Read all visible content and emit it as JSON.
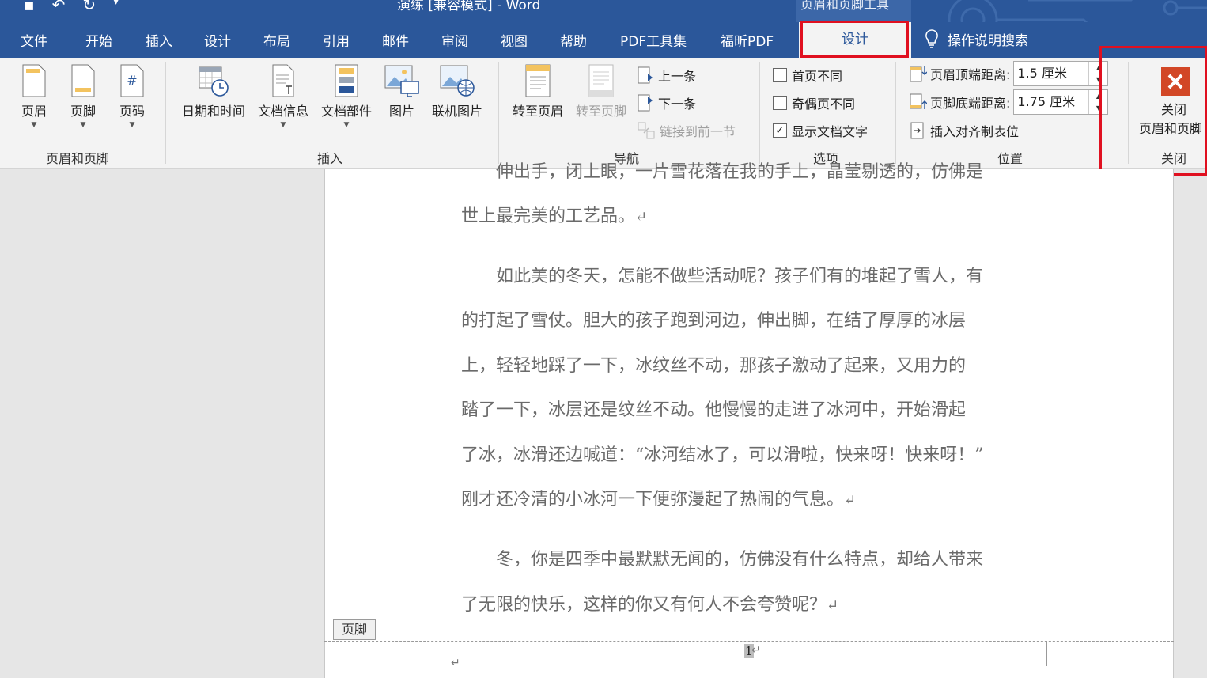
{
  "window": {
    "title": "演练 [兼容模式] - Word",
    "context_title": "页眉和页脚工具"
  },
  "tabs": [
    "文件",
    "开始",
    "插入",
    "设计",
    "布局",
    "引用",
    "邮件",
    "审阅",
    "视图",
    "帮助",
    "PDF工具集",
    "福昕PDF"
  ],
  "context_tab": "设计",
  "tell_me": "操作说明搜索",
  "ribbon": {
    "hf_group": {
      "label": "页眉和页脚",
      "header": "页眉",
      "footer": "页脚",
      "page_number": "页码"
    },
    "insert_group": {
      "label": "插入",
      "datetime": "日期和时间",
      "docinfo": "文档信息",
      "quickparts": "文档部件",
      "picture": "图片",
      "online_picture": "联机图片"
    },
    "nav_group": {
      "label": "导航",
      "goto_header": "转至页眉",
      "goto_footer": "转至页脚",
      "previous": "上一条",
      "next": "下一条",
      "link_prev": "链接到前一节"
    },
    "options_group": {
      "label": "选项",
      "diff_first": "首页不同",
      "diff_odd_even": "奇偶页不同",
      "show_text": "显示文档文字",
      "show_text_checked": "✓"
    },
    "position_group": {
      "label": "位置",
      "header_top_label": "页眉顶端距离:",
      "header_top_value": "1.5 厘米",
      "footer_bottom_label": "页脚底端距离:",
      "footer_bottom_value": "1.75 厘米",
      "align_tab": "插入对齐制表位"
    },
    "close_group": {
      "label": "关闭",
      "close_line1": "关闭",
      "close_line2": "页眉和页脚"
    }
  },
  "document": {
    "lines": [
      "伸出手，闭上眼，一片雪花落在我的手上，晶莹剔透的，仿佛是",
      "世上最完美的工艺品。",
      "如此美的冬天，怎能不做些活动呢？孩子们有的堆起了雪人，有",
      "的打起了雪仗。胆大的孩子跑到河边，伸出脚，在结了厚厚的冰层",
      "上，轻轻地踩了一下，冰纹丝不动，那孩子激动了起来，又用力的",
      "踏了一下，冰层还是纹丝不动。他慢慢的走进了冰河中，开始滑起",
      "了冰，冰滑还边喊道：“冰河结冰了，可以滑啦，快来呀！快来呀！”",
      "刚才还冷清的小冰河一下便弥漫起了热闹的气息。",
      "冬，你是四季中最默默无闻的，仿佛没有什么特点，却给人带来",
      "了无限的快乐，这样的你又有何人不会夸赞呢？"
    ],
    "paragraph_mark": "↵",
    "footer_tag": "页脚",
    "page_number": "1"
  },
  "colors": {
    "word_blue": "#2b579a",
    "highlight_red": "#e01020",
    "close_orange": "#d24726"
  }
}
